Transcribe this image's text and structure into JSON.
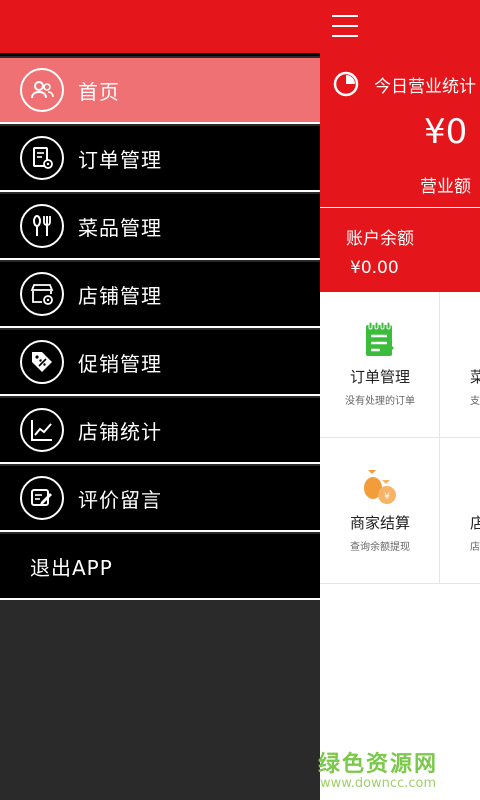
{
  "drawer": {
    "items": [
      {
        "label": "首页",
        "icon": "users-icon",
        "active": true
      },
      {
        "label": "订单管理",
        "icon": "order-settings-icon"
      },
      {
        "label": "菜品管理",
        "icon": "fork-knife-icon"
      },
      {
        "label": "店铺管理",
        "icon": "shop-settings-icon"
      },
      {
        "label": "促销管理",
        "icon": "discount-tag-icon"
      },
      {
        "label": "店铺统计",
        "icon": "line-chart-icon"
      },
      {
        "label": "评价留言",
        "icon": "edit-comment-icon"
      },
      {
        "label": "退出APP"
      }
    ]
  },
  "main": {
    "stats_title": "今日营业统计",
    "revenue_value": "¥0",
    "revenue_label": "营业额",
    "balance_title": "账户余额",
    "balance_value": "¥0.00",
    "grid": [
      {
        "title": "订单管理",
        "sub": "没有处理的订单",
        "icon": "order-list-icon"
      },
      {
        "title": "菜",
        "sub": "支持",
        "icon": ""
      },
      {
        "title": "商家结算",
        "sub": "查询余额提现",
        "icon": "money-bag-icon"
      },
      {
        "title": "店",
        "sub": "店铺",
        "icon": ""
      }
    ]
  },
  "watermark": {
    "title": "绿色资源网",
    "url": "www.downcc.com"
  },
  "colors": {
    "brand_red": "#e4151b",
    "active_item": "#ef7173",
    "icon_green": "#3bbd3b",
    "icon_orange": "#f39c3a",
    "watermark_green": "#7bc94a"
  }
}
